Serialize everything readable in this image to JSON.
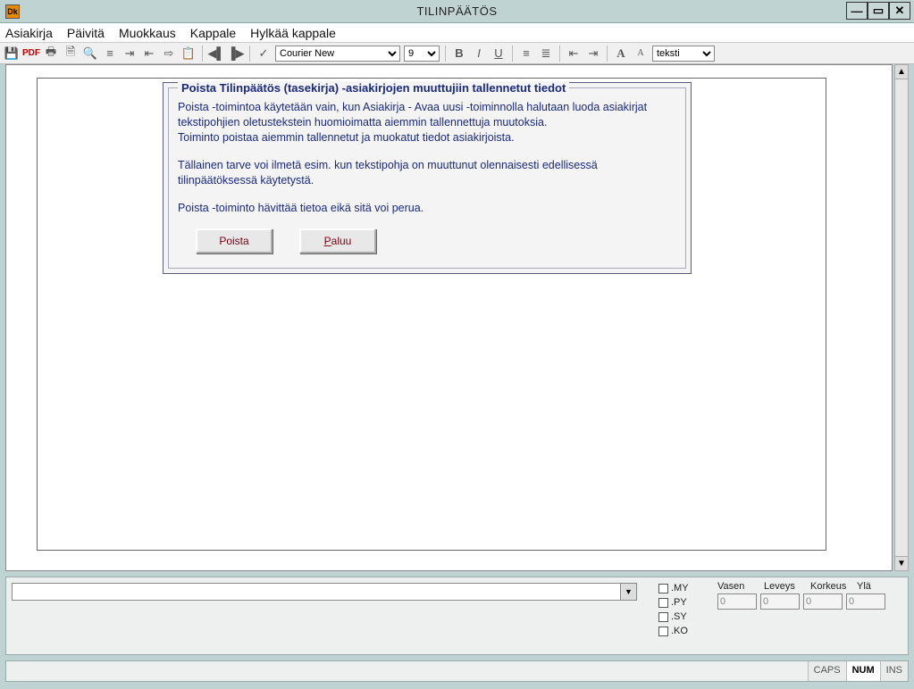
{
  "window": {
    "title": "TILINPÄÄTÖS",
    "icon_text": "Dk"
  },
  "menu": {
    "items": [
      "Asiakirja",
      "Päivitä",
      "Muokkaus",
      "Kappale",
      "Hylkää kappale"
    ]
  },
  "toolbar": {
    "pdf_label": "PDF",
    "font_name": "Courier New",
    "font_size": "9",
    "bold": "B",
    "italic": "I",
    "underline": "U",
    "style_selector": "teksti"
  },
  "dialog": {
    "title": "Poista Tilinpäätös (tasekirja) -asiakirjojen muuttujiin tallennetut tiedot",
    "para1": "Poista -toimintoa käytetään vain, kun Asiakirja - Avaa uusi -toiminnolla halutaan luoda asiakirjat tekstipohjien oletustekstein huomioimatta aiemmin tallennettuja muutoksia.",
    "para1b": "Toiminto poistaa aiemmin tallennetut ja muokatut tiedot asiakirjoista.",
    "para2": "Tällainen tarve voi ilmetä esim. kun tekstipohja on muuttunut olennaisesti edellisessä tilinpäätöksessä käytetystä.",
    "para3": "Poista -toiminto hävittää tietoa eikä sitä voi perua.",
    "btn_delete": "Poista",
    "btn_return_prefix": "P",
    "btn_return_rest": "aluu"
  },
  "bottom": {
    "checks": [
      ".MY",
      ".PY",
      ".SY",
      ".KO"
    ],
    "dim_labels": [
      "Vasen",
      "Leveys",
      "Korkeus",
      "Ylä"
    ],
    "dim_values": [
      "0",
      "0",
      "0",
      "0"
    ]
  },
  "status": {
    "caps": "CAPS",
    "num": "NUM",
    "ins": "INS"
  }
}
